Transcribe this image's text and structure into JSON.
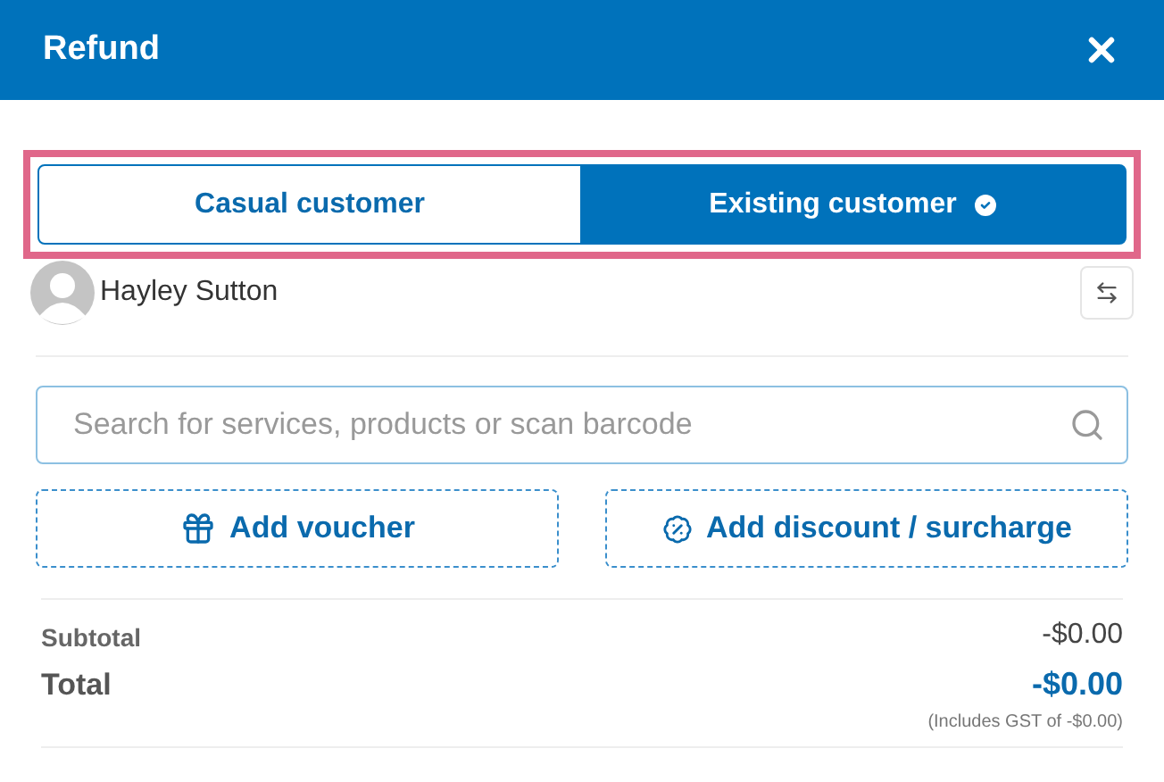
{
  "window": {
    "title": "Refund"
  },
  "customer_type": [
    {
      "label": "Casual customer",
      "selected": false
    },
    {
      "label": "Existing customer",
      "selected": true
    }
  ],
  "customer": {
    "name": "Hayley Sutton"
  },
  "search": {
    "placeholder": "Search for services, products or scan barcode"
  },
  "actions": [
    {
      "kind": "voucher",
      "label": "Add voucher"
    },
    {
      "kind": "discount",
      "label": "Add discount / surcharge"
    }
  ],
  "totals": {
    "subtotal_label": "Subtotal",
    "subtotal": "-$0.00",
    "total_label": "Total",
    "total": "-$0.00",
    "tax_note": "(Includes GST of -$0.00)"
  }
}
